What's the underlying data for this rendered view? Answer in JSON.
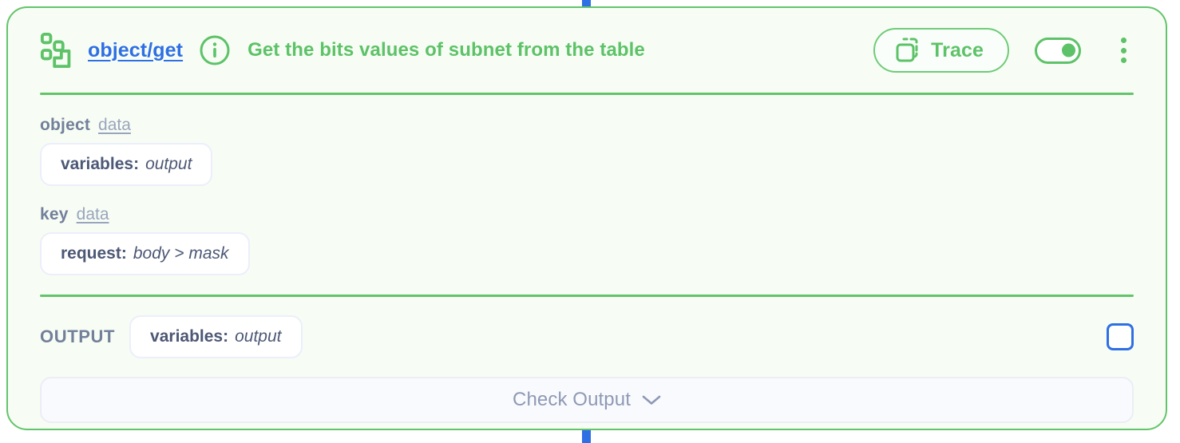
{
  "connectors": {
    "top_color": "#2f6fe4",
    "bottom_color": "#2f6fe4"
  },
  "node": {
    "accent_color": "#5dc268",
    "background_color": "#f7fdf4",
    "border_color": "#62c46a",
    "header": {
      "type_icon": "object-structure-icon",
      "type_link": "object/get",
      "type_link_color": "#2f6fe4",
      "info_icon": "info-circle-icon",
      "title": "Get the bits values of subnet from the table",
      "trace": {
        "label": "Trace",
        "icon": "copy-duplicate-icon"
      },
      "toggle": {
        "name": "enable-node-toggle",
        "state": "on"
      },
      "menu_icon": "kebab-menu-icon"
    },
    "params": [
      {
        "name": "object",
        "kind": "data",
        "value_key": "variables:",
        "value": "output"
      },
      {
        "name": "key",
        "kind": "data",
        "value_key": "request:",
        "value": "body > mask"
      }
    ],
    "output": {
      "label": "OUTPUT",
      "value_key": "variables:",
      "value": "output",
      "checkbox_checked": false,
      "checkbox_color": "#2f6fe4"
    },
    "check_output": {
      "label": "Check Output",
      "chevron_icon": "chevron-down-icon"
    }
  }
}
